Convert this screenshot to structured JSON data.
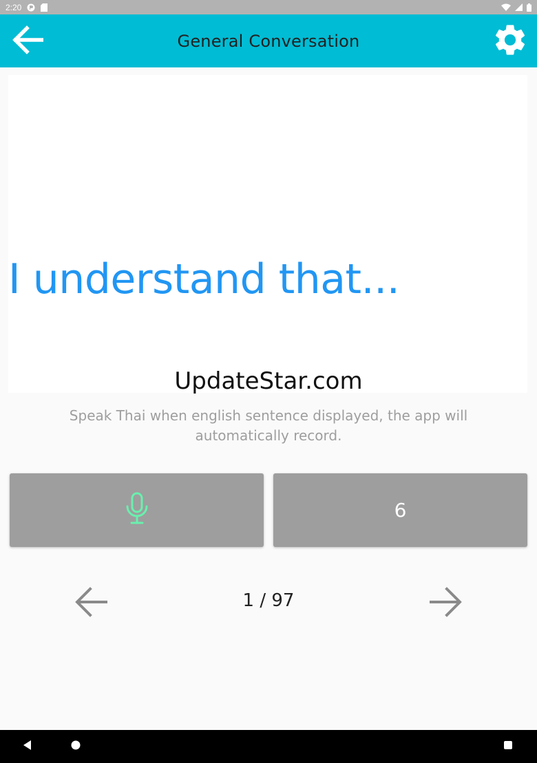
{
  "status_bar": {
    "time": "2:20",
    "icons": [
      "notification-icon",
      "sd-card-icon",
      "wifi-icon",
      "signal-icon",
      "battery-icon"
    ]
  },
  "app_bar": {
    "title": "General Conversation",
    "back_icon": "arrow-back-icon",
    "settings_icon": "gear-icon",
    "color": "#00bcd4"
  },
  "card": {
    "sentence": "I understand that...",
    "sentence_color": "#2196f3"
  },
  "watermark": "UpdateStar.com",
  "hint": "Speak Thai when english sentence displayed, the app will automatically record.",
  "buttons": {
    "mic_icon": "microphone-icon",
    "mic_color": "#69f0ae",
    "count_label": "6"
  },
  "pager": {
    "indicator": "1 / 97",
    "prev_icon": "arrow-left-icon",
    "next_icon": "arrow-right-icon"
  },
  "nav_bar": {
    "icons": [
      "back-triangle-icon",
      "home-circle-icon",
      "recents-square-icon"
    ]
  }
}
